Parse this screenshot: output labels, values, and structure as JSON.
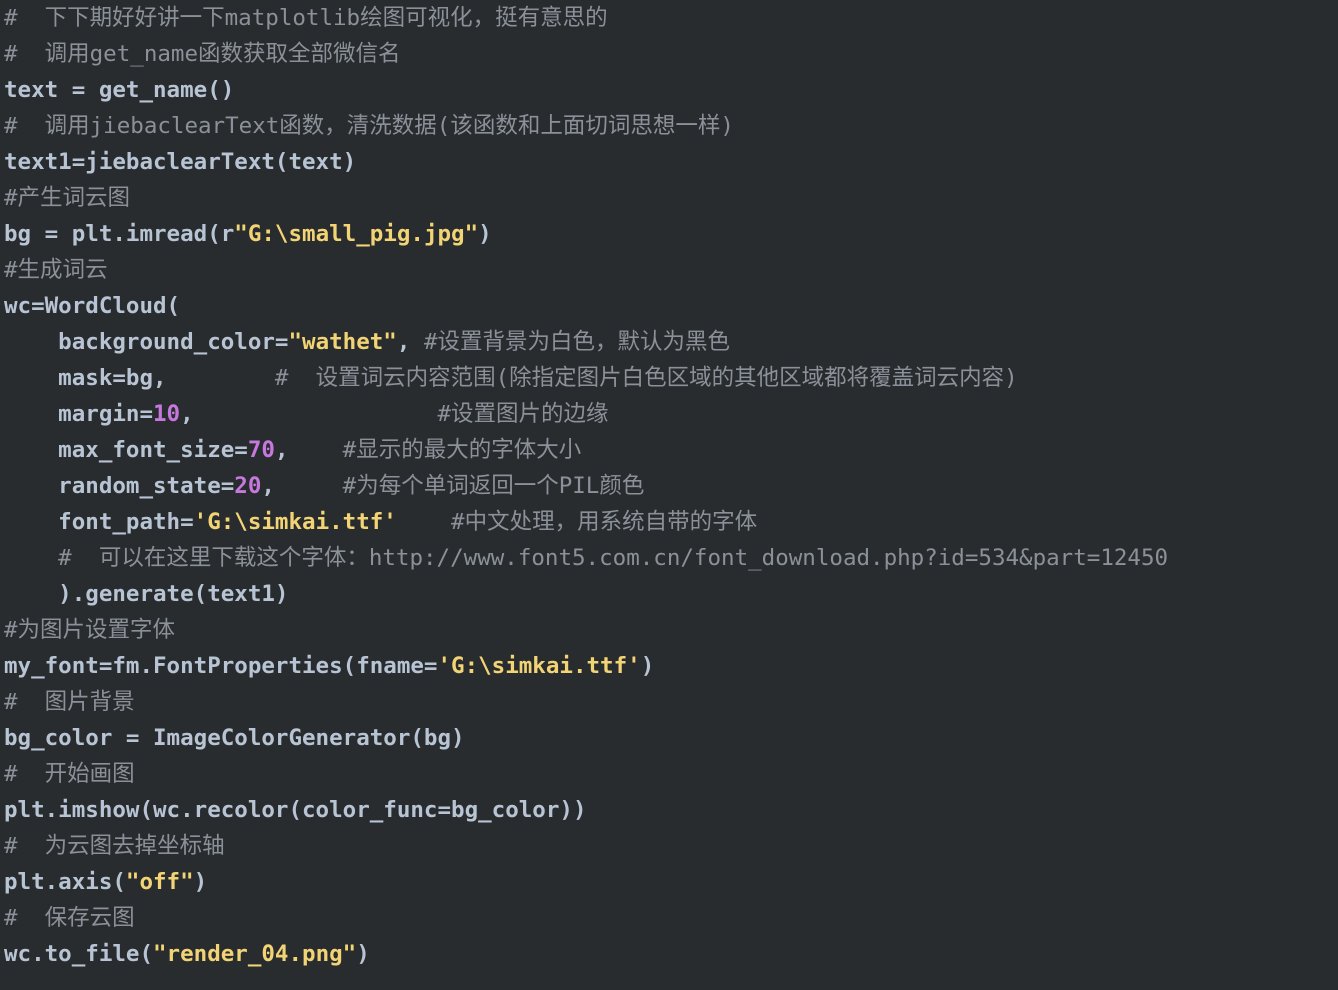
{
  "editor": {
    "name": "python-code-view",
    "language": "Python",
    "background_color": "#282c2f",
    "colors": {
      "plain": "#b8c4d4",
      "comment": "#8b9199",
      "string": "#f2d475",
      "number": "#c678dd"
    },
    "lines": [
      {
        "n": 1,
        "tokens": [
          {
            "t": "comment",
            "s": "#  下下期好好讲一下matplotlib绘图可视化，挺有意思的"
          }
        ]
      },
      {
        "n": 2,
        "tokens": [
          {
            "t": "comment",
            "s": "#  调用get_name函数获取全部微信名"
          }
        ]
      },
      {
        "n": 3,
        "tokens": [
          {
            "t": "plain",
            "s": "text = get_name()"
          }
        ]
      },
      {
        "n": 4,
        "tokens": [
          {
            "t": "comment",
            "s": "#  调用jiebaclearText函数，清洗数据(该函数和上面切词思想一样)"
          }
        ]
      },
      {
        "n": 5,
        "tokens": [
          {
            "t": "plain",
            "s": "text1=jiebaclearText(text)"
          }
        ]
      },
      {
        "n": 6,
        "tokens": [
          {
            "t": "comment",
            "s": "#产生词云图"
          }
        ]
      },
      {
        "n": 7,
        "tokens": [
          {
            "t": "plain",
            "s": "bg = plt.imread(r"
          },
          {
            "t": "string",
            "s": "\"G:\\small_pig.jpg\""
          },
          {
            "t": "plain",
            "s": ")"
          }
        ]
      },
      {
        "n": 8,
        "tokens": [
          {
            "t": "comment",
            "s": "#生成词云"
          }
        ]
      },
      {
        "n": 9,
        "tokens": [
          {
            "t": "plain",
            "s": "wc=WordCloud("
          }
        ]
      },
      {
        "n": 10,
        "tokens": [
          {
            "t": "plain",
            "s": "    background_color="
          },
          {
            "t": "string",
            "s": "\"wathet\""
          },
          {
            "t": "plain",
            "s": ", "
          },
          {
            "t": "comment",
            "s": "#设置背景为白色，默认为黑色"
          }
        ]
      },
      {
        "n": 11,
        "tokens": [
          {
            "t": "plain",
            "s": "    mask=bg,"
          },
          {
            "t": "comment",
            "s": "        #  设置词云内容范围(除指定图片白色区域的其他区域都将覆盖词云内容)"
          }
        ]
      },
      {
        "n": 12,
        "tokens": [
          {
            "t": "plain",
            "s": "    margin="
          },
          {
            "t": "number",
            "s": "10"
          },
          {
            "t": "plain",
            "s": ","
          },
          {
            "t": "comment",
            "s": "                  #设置图片的边缘"
          }
        ]
      },
      {
        "n": 13,
        "tokens": [
          {
            "t": "plain",
            "s": "    max_font_size="
          },
          {
            "t": "number",
            "s": "70"
          },
          {
            "t": "plain",
            "s": ","
          },
          {
            "t": "comment",
            "s": "    #显示的最大的字体大小"
          }
        ]
      },
      {
        "n": 14,
        "tokens": [
          {
            "t": "plain",
            "s": "    random_state="
          },
          {
            "t": "number",
            "s": "20"
          },
          {
            "t": "plain",
            "s": ","
          },
          {
            "t": "comment",
            "s": "     #为每个单词返回一个PIL颜色"
          }
        ]
      },
      {
        "n": 15,
        "tokens": [
          {
            "t": "plain",
            "s": "    font_path="
          },
          {
            "t": "string",
            "s": "'G:\\simkai.ttf'"
          },
          {
            "t": "comment",
            "s": "    #中文处理，用系统自带的字体"
          }
        ]
      },
      {
        "n": 16,
        "tokens": [
          {
            "t": "comment",
            "s": "    #  可以在这里下载这个字体：http://www.font5.com.cn/font_download.php?id=534&part=12450"
          }
        ]
      },
      {
        "n": 17,
        "tokens": [
          {
            "t": "plain",
            "s": "    ).generate(text1)"
          }
        ]
      },
      {
        "n": 18,
        "tokens": [
          {
            "t": "comment",
            "s": "#为图片设置字体"
          }
        ]
      },
      {
        "n": 19,
        "tokens": [
          {
            "t": "plain",
            "s": "my_font=fm.FontProperties(fname="
          },
          {
            "t": "string",
            "s": "'G:\\simkai.ttf'"
          },
          {
            "t": "plain",
            "s": ")"
          }
        ]
      },
      {
        "n": 20,
        "tokens": [
          {
            "t": "comment",
            "s": "#  图片背景"
          }
        ]
      },
      {
        "n": 21,
        "tokens": [
          {
            "t": "plain",
            "s": "bg_color = ImageColorGenerator(bg)"
          }
        ]
      },
      {
        "n": 22,
        "tokens": [
          {
            "t": "comment",
            "s": "#  开始画图"
          }
        ]
      },
      {
        "n": 23,
        "tokens": [
          {
            "t": "plain",
            "s": "plt.imshow(wc.recolor(color_func=bg_color))"
          }
        ]
      },
      {
        "n": 24,
        "tokens": [
          {
            "t": "comment",
            "s": "#  为云图去掉坐标轴"
          }
        ]
      },
      {
        "n": 25,
        "tokens": [
          {
            "t": "plain",
            "s": "plt.axis("
          },
          {
            "t": "string",
            "s": "\"off\""
          },
          {
            "t": "plain",
            "s": ")"
          }
        ]
      },
      {
        "n": 26,
        "tokens": [
          {
            "t": "comment",
            "s": "#  保存云图"
          }
        ]
      },
      {
        "n": 27,
        "tokens": [
          {
            "t": "plain",
            "s": "wc.to_file("
          },
          {
            "t": "string",
            "s": "\"render_04.png\""
          },
          {
            "t": "plain",
            "s": ")"
          }
        ]
      }
    ]
  }
}
